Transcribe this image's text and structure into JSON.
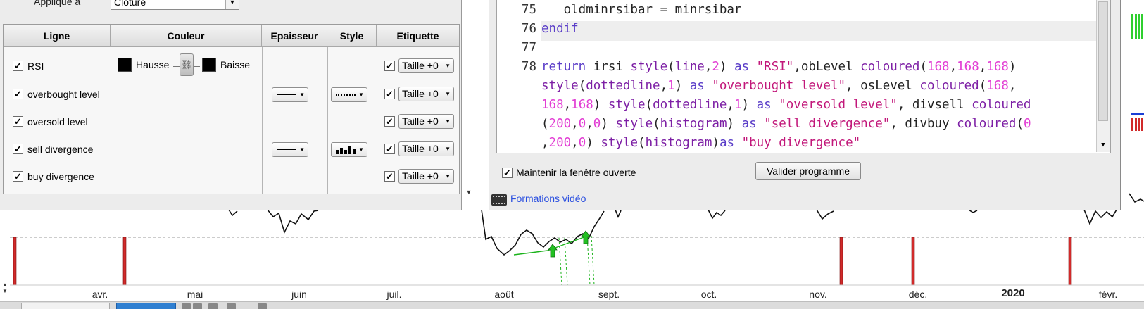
{
  "chart": {
    "months": [
      "avr.",
      "mai",
      "juin",
      "juil.",
      "août",
      "sept.",
      "oct.",
      "nov.",
      "déc.",
      "2020",
      "févr."
    ]
  },
  "properties_panel": {
    "apply_label": "Appliqué à",
    "apply_value": "Clôture",
    "columns": [
      "Ligne",
      "Couleur",
      "Epaisseur",
      "Style",
      "Etiquette"
    ],
    "rows": [
      {
        "label": "RSI",
        "checked": true,
        "etiquette": "Taille +0"
      },
      {
        "label": "overbought level",
        "checked": true,
        "etiquette": "Taille +0"
      },
      {
        "label": "oversold level",
        "checked": true,
        "etiquette": "Taille +0"
      },
      {
        "label": "sell divergence",
        "checked": true,
        "etiquette": "Taille +0"
      },
      {
        "label": "buy divergence",
        "checked": true,
        "etiquette": "Taille +0"
      }
    ],
    "color_up_label": "Hausse",
    "color_down_label": "Baisse",
    "color_up": "#000000",
    "color_down": "#000000"
  },
  "editor": {
    "line_numbers": [
      "75",
      "76",
      "77",
      "78"
    ],
    "code": {
      "l75": "   oldminrsibar = minrsibar",
      "l76": "endif",
      "l77": "",
      "l78_a_kw": "return",
      "l78_a_1": " irsi ",
      "l78_a_fn": "style",
      "l78_a_2": "(",
      "l78_a_arg": "line",
      "l78_a_3": ",",
      "l78_a_num": "2",
      "l78_a_4": ") ",
      "l78_a_as": "as",
      "l78_a_5": " ",
      "l78_a_str": "\"RSI\"",
      "l78_a_6": ",obLevel ",
      "l78_a_col": "coloured",
      "l78_a_7": "(",
      "l78_a_n1": "168",
      "l78_a_8": ",",
      "l78_a_n2": "168",
      "l78_a_9": ",",
      "l78_a_n3": "168",
      "l78_a_10": ")",
      "l78_b_fn": "style",
      "l78_b_1": "(",
      "l78_b_arg": "dottedline",
      "l78_b_2": ",",
      "l78_b_num": "1",
      "l78_b_3": ") ",
      "l78_b_as": "as",
      "l78_b_4": " ",
      "l78_b_str": "\"overbought level\"",
      "l78_b_5": ", osLevel ",
      "l78_b_col": "coloured",
      "l78_b_6": "(",
      "l78_b_n1": "168",
      "l78_b_7": ",",
      "l78_c_n2": "168",
      "l78_c_1": ",",
      "l78_c_n3": "168",
      "l78_c_2": ") ",
      "l78_c_fn": "style",
      "l78_c_3": "(",
      "l78_c_arg": "dottedline",
      "l78_c_4": ",",
      "l78_c_num": "1",
      "l78_c_5": ") ",
      "l78_c_as": "as",
      "l78_c_6": " ",
      "l78_c_str": "\"oversold level\"",
      "l78_c_7": ", divsell ",
      "l78_c_col": "coloured",
      "l78_d_1": "(",
      "l78_d_n1": "200",
      "l78_d_2": ",",
      "l78_d_n2": "0",
      "l78_d_3": ",",
      "l78_d_n3": "0",
      "l78_d_4": ") ",
      "l78_d_fn": "style",
      "l78_d_5": "(",
      "l78_d_arg": "histogram",
      "l78_d_6": ") ",
      "l78_d_as": "as",
      "l78_d_7": " ",
      "l78_d_str": "\"sell divergence\"",
      "l78_d_8": ", divbuy ",
      "l78_d_col": "coloured",
      "l78_d_9": "(",
      "l78_d_n4": "0",
      "l78_e_1": ",",
      "l78_e_n1": "200",
      "l78_e_2": ",",
      "l78_e_n2": "0",
      "l78_e_3": ") ",
      "l78_e_fn": "style",
      "l78_e_4": "(",
      "l78_e_arg": "histogram",
      "l78_e_5": ")",
      "l78_e_as": "as",
      "l78_e_6": " ",
      "l78_e_str": "\"buy divergence\""
    },
    "keep_open_label": "Maintenir la fenêtre ouverte",
    "keep_open_checked": true,
    "validate_button": "Valider programme",
    "video_link": "Formations vidéo"
  }
}
